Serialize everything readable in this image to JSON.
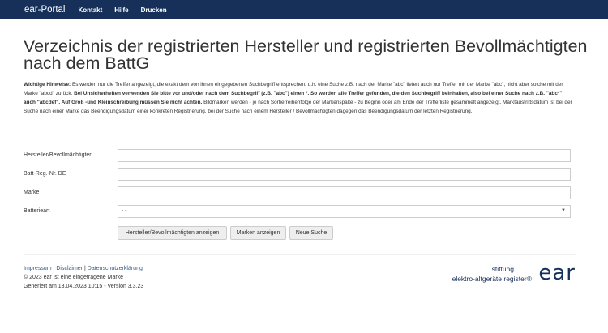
{
  "navbar": {
    "brand": "ear-Portal",
    "links": [
      "Kontakt",
      "Hilfe",
      "Drucken"
    ]
  },
  "page": {
    "title": "Verzeichnis der registrierten Hersteller und registrierten Bevollmächtigten nach dem BattG"
  },
  "notice": {
    "label": "Wichtige Hinweise:",
    "text1": " Es werden nur die Treffer angezeigt, die exakt dem von ihnen eingegebenen Suchbegriff entsprechen. d.h. eine Suche z.B. nach der Marke \"abc\" liefert auch nur Treffer mit der Marke \"abc\", nicht aber solche mit der Marke \"abcd\" zurück. ",
    "bold": "Bei Unsicherheiten verwenden Sie bitte vor und/oder nach dem Suchbegriff (z.B. \"abc\") einen *. So werden alle Treffer gefunden, die den Suchbegriff beinhalten, also bei einer Suche nach z.B. \"abc*\" auch \"abcdef\". Auf Groß -und Kleinschreibung müssen Sie nicht achten.",
    "text2": " Bildmarken werden - je nach Sortierreihenfolge der Markenspalte - zu Beginn oder am Ende der Trefferliste gesammelt angezeigt. Marktaustrittsdatum ist bei der Suche nach einer Marke das Beendigungsdatum einer konkreten Registrierung, bei der Suche nach einem Hersteller / Bevollmächtigten dagegen das Beendigungsdatum der letzten Registrierung."
  },
  "form": {
    "hersteller_label": "Hersteller/Bevollmächtigter",
    "hersteller_value": "",
    "regnr_label": "Batt-Reg.-Nr. DE",
    "regnr_value": "",
    "marke_label": "Marke",
    "marke_value": "",
    "batterieart_label": "Batterieart",
    "batterieart_selected": "- -"
  },
  "buttons": {
    "show_hersteller": "Hersteller/Bevollmächtigten anzeigen",
    "show_marken": "Marken anzeigen",
    "new_search": "Neue Suche"
  },
  "footer": {
    "impressum": "Impressum",
    "disclaimer": "Disclaimer",
    "datenschutz": "Datenschutzerklärung",
    "separator": "|",
    "copyright": "© 2023 ear ist eine eingetragene Marke",
    "generated": "Generiert am 13.04.2023 10:15 - Version 3.3.23"
  },
  "logo": {
    "line1": "stiftung",
    "line2": "elektro-altgeräte register",
    "registered": "®",
    "mark": "ear"
  },
  "colors": {
    "navbar": "#17305a",
    "link": "#335a8a",
    "logo": "#17305a"
  }
}
